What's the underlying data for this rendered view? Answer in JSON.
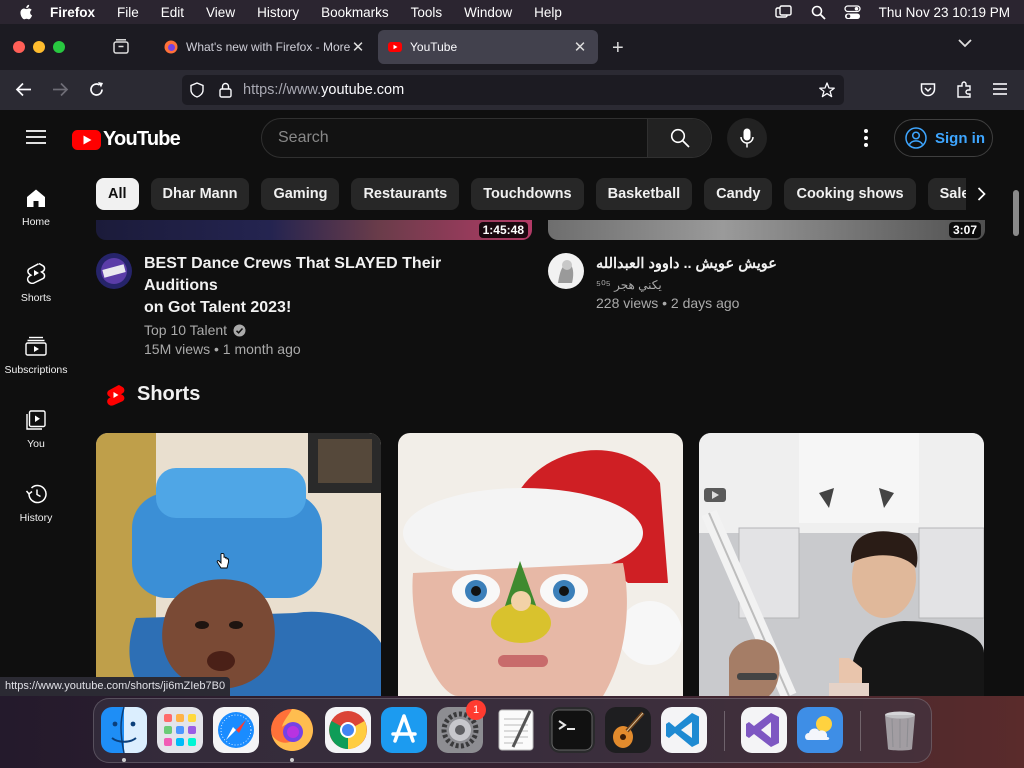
{
  "menubar": {
    "app": "Firefox",
    "items": [
      "File",
      "Edit",
      "View",
      "History",
      "Bookmarks",
      "Tools",
      "Window",
      "Help"
    ],
    "clock": "Thu Nov 23  10:19 PM"
  },
  "tabs": [
    {
      "title": "What's new with Firefox - More",
      "active": false
    },
    {
      "title": "YouTube",
      "active": true
    }
  ],
  "url": {
    "prefix": "https://www.",
    "domain": "youtube.com"
  },
  "youtube": {
    "logo_text": "YouTube",
    "search_placeholder": "Search",
    "signin_label": "Sign in",
    "chips": [
      "All",
      "Dhar Mann",
      "Gaming",
      "Restaurants",
      "Touchdowns",
      "Basketball",
      "Candy",
      "Cooking shows",
      "Sales"
    ],
    "sidebar": [
      {
        "label": "Home",
        "icon": "home-icon"
      },
      {
        "label": "Shorts",
        "icon": "shorts-icon"
      },
      {
        "label": "Subscriptions",
        "icon": "subscriptions-icon"
      },
      {
        "label": "You",
        "icon": "you-icon"
      },
      {
        "label": "History",
        "icon": "history-icon"
      }
    ],
    "videos": [
      {
        "duration": "1:45:48",
        "title_line1": "BEST Dance Crews That SLAYED Their Auditions",
        "title_line2": "on Got Talent 2023!",
        "channel": "Top 10 Talent",
        "verified": true,
        "stats": "15M views • 1 month ago"
      },
      {
        "duration": "3:07",
        "title_line1": "عويش عويش .. داوود العبدالله",
        "title_line2": "",
        "channel": "يكني هجر ⁵⁰⁵",
        "verified": false,
        "stats": "228 views • 2 days ago"
      }
    ],
    "shorts_heading": "Shorts"
  },
  "status_link": "https://www.youtube.com/shorts/ji6mZIeb7B0",
  "dock": {
    "apps": [
      "Finder",
      "Launchpad",
      "Safari",
      "Firefox",
      "Chrome",
      "App Store",
      "System Settings",
      "TextEdit",
      "Terminal",
      "GarageBand",
      "Visual Studio Code",
      "Visual Studio",
      "Weather",
      "Trash"
    ],
    "settings_badge": "1"
  },
  "colors": {
    "yt_red": "#ff0000",
    "link_blue": "#3ea6ff",
    "yt_bg": "#0f0f0f"
  }
}
